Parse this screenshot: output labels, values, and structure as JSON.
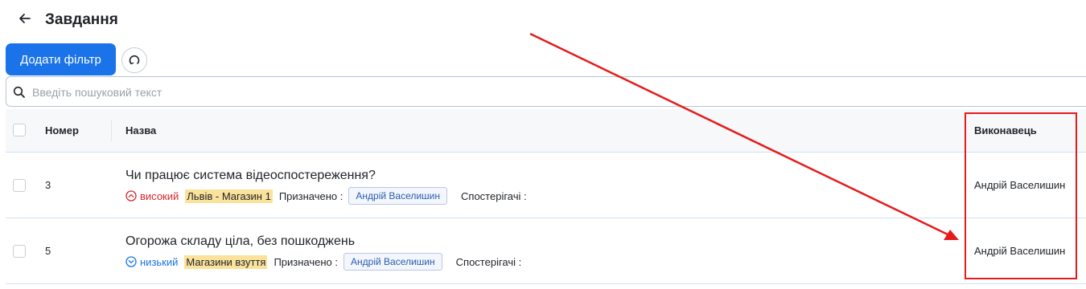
{
  "header": {
    "title": "Завдання"
  },
  "toolbar": {
    "add_filter_label": "Додати фільтр"
  },
  "search": {
    "placeholder": "Введіть пошуковий текст",
    "value": ""
  },
  "table": {
    "columns": {
      "number": "Номер",
      "title": "Назва",
      "executor": "Виконавець"
    },
    "rows": [
      {
        "number": "3",
        "title": "Чи працює система відеоспостереження?",
        "priority": "високий",
        "store": "Львів - Магазин 1",
        "assigned_label": "Призначено",
        "assignee": "Андрій Васелишин",
        "watchers_label": "Спостерігачі",
        "executor": "Андрій Васелишин"
      },
      {
        "number": "5",
        "title": "Огорожа складу ціла, без пошкоджень",
        "priority": "низький",
        "store": "Магазини взуття",
        "assigned_label": "Призначено",
        "assignee": "Андрій Васелишин",
        "watchers_label": "Спостерігачі",
        "executor": "Андрій Васелишин"
      }
    ]
  },
  "colors": {
    "primary": "#1a73e8",
    "high_priority": "#d7262a",
    "low_priority": "#1a73e8",
    "store_highlight": "#fbe29a",
    "annotation": "#e51b1b"
  },
  "icons": {
    "back": "arrow-left-icon",
    "reset": "refresh-icon",
    "search": "search-icon",
    "high": "chevron-up-circle-icon",
    "low": "chevron-down-circle-icon"
  }
}
